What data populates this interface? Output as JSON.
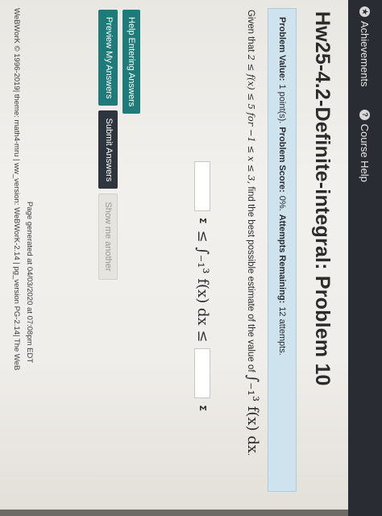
{
  "nav": {
    "achievements": "Achievements",
    "course_help": "Course Help"
  },
  "page": {
    "title": "Hw25-4.2-Definite-integral: Problem 10"
  },
  "info": {
    "value_label": "Problem Value:",
    "value": "1 point(s).",
    "score_label": "Problem Score:",
    "score": "0%.",
    "attempts_label": "Attempts Remaining:",
    "attempts": "12 attempts."
  },
  "problem": {
    "given_prefix": "Given that",
    "given_math": "2 ≤ f(x) ≤ 5 for −1 ≤ x ≤ 3,",
    "question": "find the best possible estimate of the value of",
    "integral": "∫₋₁³ f(x) dx",
    "period": ".",
    "integral_center": "≤ ∫₋₁³ f(x) dx ≤",
    "sigma": "Σ"
  },
  "buttons": {
    "help": "Help Entering Answers",
    "preview": "Preview My Answers",
    "submit": "Submit Answers",
    "show": "Show me another"
  },
  "footer": {
    "generated": "Page generated at 04/03/2020 at 07:08pm EDT",
    "copyright": "WeBWorK © 1996-2019| theme: math4-mru | ww_version: WeBWorK-2.14 | pg_version PG-2.14| The WeB"
  }
}
